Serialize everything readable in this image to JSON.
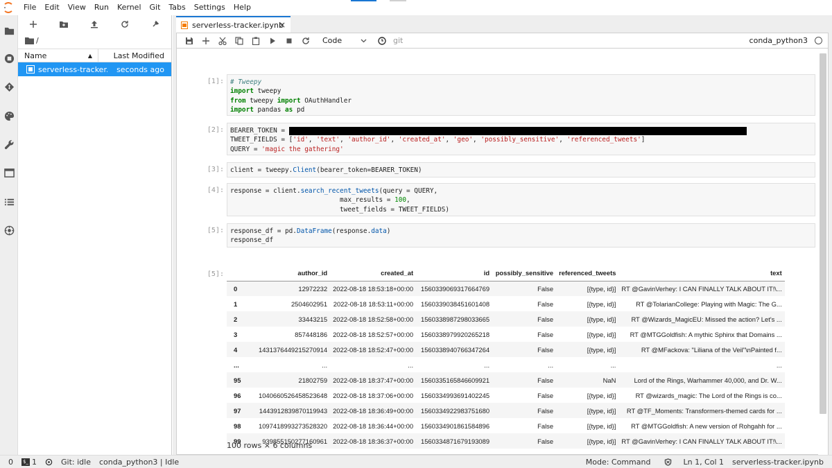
{
  "menubar": {
    "items": [
      "File",
      "Edit",
      "View",
      "Run",
      "Kernel",
      "Git",
      "Tabs",
      "Settings",
      "Help"
    ]
  },
  "filebrowser": {
    "path": "/",
    "columns": {
      "name": "Name",
      "modified": "Last Modified"
    },
    "files": [
      {
        "name": "serverless-tracker...",
        "modified": "seconds ago"
      }
    ]
  },
  "tab": {
    "title": "serverless-tracker.ipynb",
    "close": "×"
  },
  "toolbar": {
    "cell_type": "Code",
    "git_label": "git",
    "kernel": "conda_python3"
  },
  "cells": {
    "c1": {
      "prompt": "[1]:"
    },
    "c2": {
      "prompt": "[2]:"
    },
    "c3": {
      "prompt": "[3]:"
    },
    "c4": {
      "prompt": "[4]:"
    },
    "c5": {
      "prompt": "[5]:"
    },
    "out5": {
      "prompt": "[5]:"
    }
  },
  "dataframe": {
    "columns": [
      "",
      "author_id",
      "created_at",
      "id",
      "possibly_sensitive",
      "referenced_tweets",
      "text"
    ],
    "rows": [
      [
        "0",
        "12972232",
        "2022-08-18 18:53:18+00:00",
        "1560339069317664769",
        "False",
        "[{type, id}]",
        "RT @GavinVerhey: I CAN FINALLY TALK ABOUT IT!\\..."
      ],
      [
        "1",
        "2504602951",
        "2022-08-18 18:53:11+00:00",
        "1560339038451601408",
        "False",
        "[{type, id}]",
        "RT @TolarianCollege: Playing with Magic: The G..."
      ],
      [
        "2",
        "33443215",
        "2022-08-18 18:52:58+00:00",
        "1560338987298033665",
        "False",
        "[{type, id}]",
        "RT @Wizards_MagicEU: Missed the action? Let's ..."
      ],
      [
        "3",
        "857448186",
        "2022-08-18 18:52:57+00:00",
        "1560338979920265218",
        "False",
        "[{type, id}]",
        "RT @MTGGoldfish: A mythic Sphinx that Domains ..."
      ],
      [
        "4",
        "1431376449215270914",
        "2022-08-18 18:52:47+00:00",
        "1560338940766347264",
        "False",
        "[{type, id}]",
        "RT @MFackova: \"Liliana of the Veil\"\\nPainted f..."
      ],
      [
        "...",
        "...",
        "...",
        "...",
        "...",
        "...",
        "..."
      ],
      [
        "95",
        "21802759",
        "2022-08-18 18:37:47+00:00",
        "1560335165846609921",
        "False",
        "NaN",
        "Lord of the Rings, Warhammer 40,000, and Dr. W..."
      ],
      [
        "96",
        "1040660526458523648",
        "2022-08-18 18:37:06+00:00",
        "1560334993691402245",
        "False",
        "[{type, id}]",
        "RT @wizards_magic: The Lord of the Rings is co..."
      ],
      [
        "97",
        "1443912839870119943",
        "2022-08-18 18:36:49+00:00",
        "1560334922983751680",
        "False",
        "[{type, id}]",
        "RT @TF_Moments: Transformers-themed cards for ..."
      ],
      [
        "98",
        "1097418993273528320",
        "2022-08-18 18:36:44+00:00",
        "1560334901861584896",
        "False",
        "[{type, id}]",
        "RT @MTGGoldfish: A new version of Rohgahh for ..."
      ],
      [
        "99",
        "939855150277160961",
        "2022-08-18 18:36:37+00:00",
        "1560334871679193089",
        "False",
        "[{type, id}]",
        "RT @GavinVerhey: I CAN FINALLY TALK ABOUT IT!\\..."
      ]
    ],
    "shape": "100 rows × 6 columns"
  },
  "statusbar": {
    "zero": "0",
    "terminal_count": "1",
    "git": "Git: idle",
    "kernel": "conda_python3 | Idle",
    "mode": "Mode: Command",
    "position": "Ln 1, Col 1",
    "file": "serverless-tracker.ipynb"
  },
  "colors": {
    "accent": "#1976d2",
    "selected_row": "#2196f3"
  }
}
